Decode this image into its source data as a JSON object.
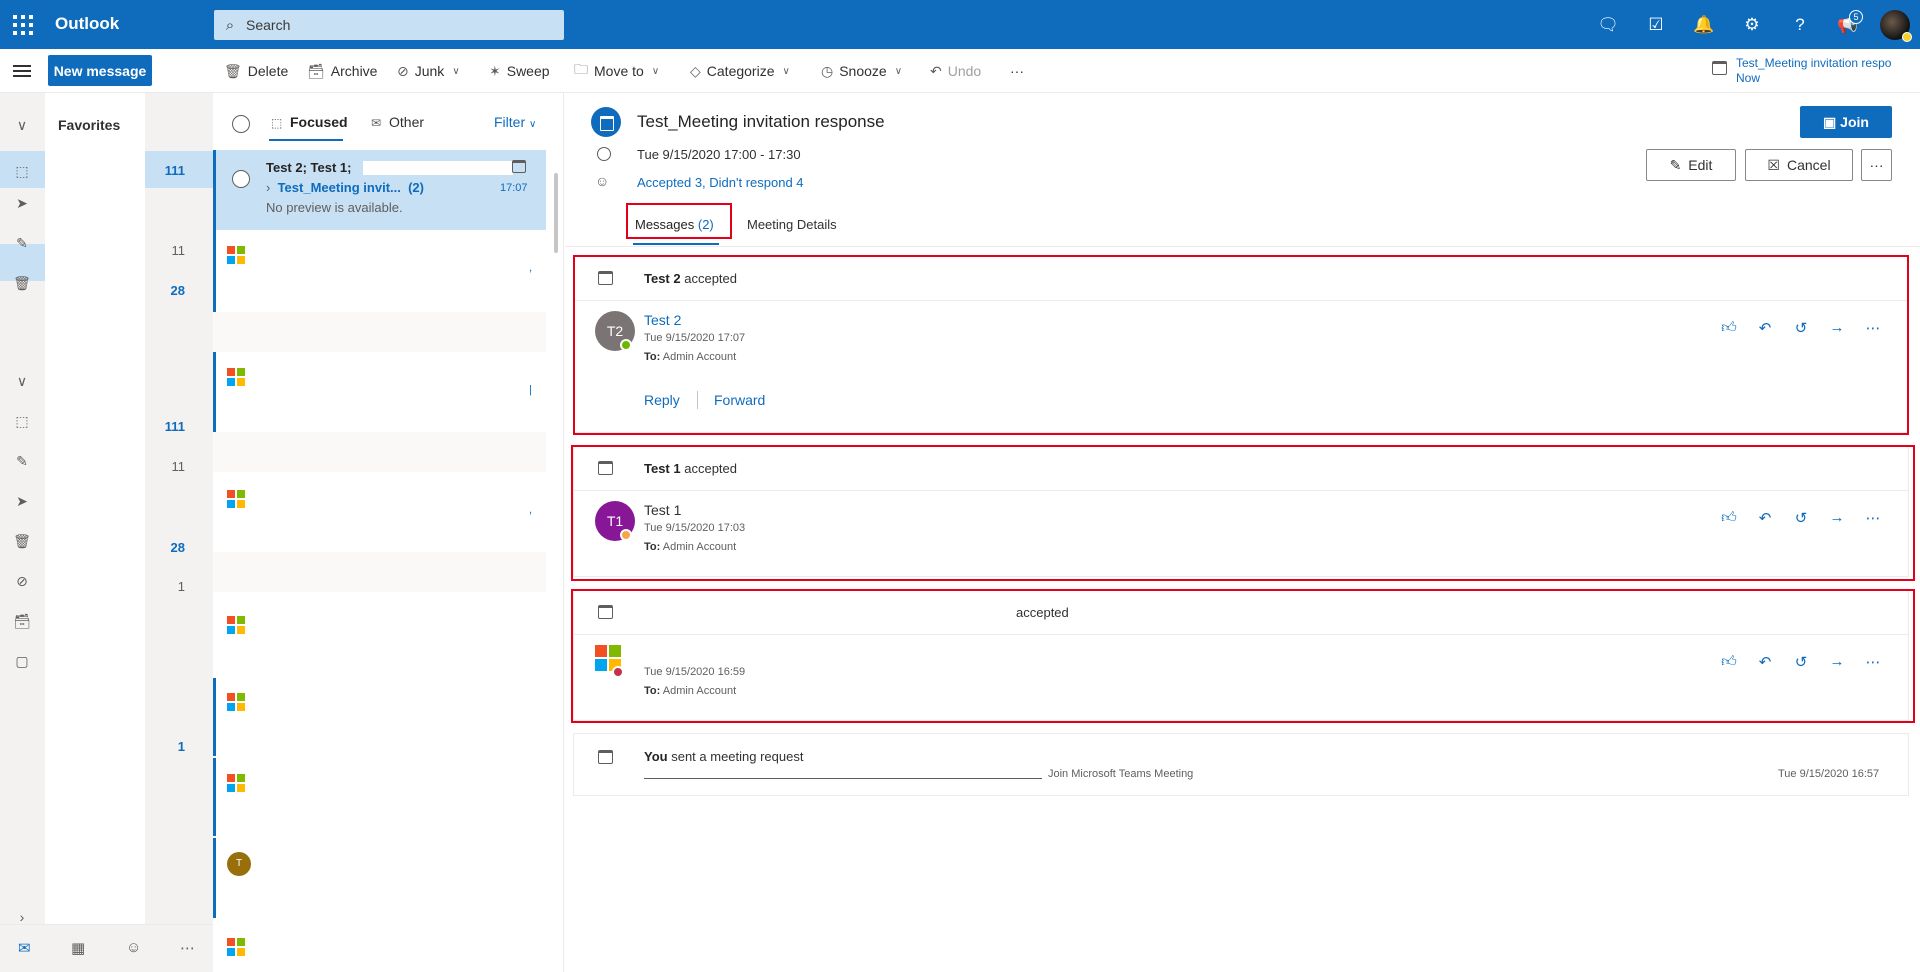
{
  "app": {
    "name": "Outlook"
  },
  "search": {
    "placeholder": "Search"
  },
  "topbar": {
    "notification_count": "5"
  },
  "toolbar": {
    "new_message": "New message",
    "delete": "Delete",
    "archive": "Archive",
    "junk": "Junk",
    "sweep": "Sweep",
    "move_to": "Move to",
    "categorize": "Categorize",
    "snooze": "Snooze",
    "undo": "Undo",
    "more": "···"
  },
  "reminder": {
    "title": "Test_Meeting invitation respo",
    "time": "Now"
  },
  "folders": {
    "favorites_label": "Favorites",
    "counts": [
      {
        "value": "111",
        "bold": true
      },
      {
        "value": "11",
        "bold": false
      },
      {
        "value": "28",
        "bold": true
      },
      {
        "value": "111",
        "bold": true
      },
      {
        "value": "11",
        "bold": false
      },
      {
        "value": "28",
        "bold": true
      },
      {
        "value": "1",
        "bold": false
      },
      {
        "value": "1",
        "bold": true
      }
    ]
  },
  "list": {
    "tab_focused": "Focused",
    "tab_other": "Other",
    "filter": "Filter",
    "selected": {
      "from": "Test 2; Test 1;",
      "subject": "Test_Meeting invit...",
      "count": "(2)",
      "time": "17:07",
      "preview": "No preview is available."
    },
    "avatar_initial": "T"
  },
  "event": {
    "subject": "Test_Meeting invitation response",
    "time": "Tue 9/15/2020 17:00 - 17:30",
    "attendees": "Accepted 3, Didn't respond 4",
    "join": "Join",
    "edit": "Edit",
    "cancel": "Cancel",
    "more": "···"
  },
  "tabs": {
    "messages": "Messages",
    "messages_count": "(2)",
    "details": "Meeting Details"
  },
  "messages": [
    {
      "head_name": "Test 2",
      "head_action": "accepted",
      "initials": "T2",
      "sender": "Test 2",
      "date": "Tue 9/15/2020 17:07",
      "to_label": "To:",
      "to": "Admin Account",
      "reply": "Reply",
      "forward": "Forward"
    },
    {
      "head_name": "Test 1",
      "head_action": "accepted",
      "initials": "T1",
      "sender": "Test 1",
      "date": "Tue 9/15/2020 17:03",
      "to_label": "To:",
      "to": "Admin Account"
    },
    {
      "head_action": "accepted",
      "date": "Tue 9/15/2020 16:59",
      "to_label": "To:",
      "to": "Admin Account"
    }
  ],
  "sent": {
    "head_name": "You",
    "head_action": "sent a meeting request",
    "teams_text": "Join Microsoft Teams Meeting",
    "date": "Tue 9/15/2020 16:57"
  },
  "colors": {
    "brand": "#0f6cbd",
    "highlight": "#e3001b",
    "selected": "#c7e0f4"
  }
}
